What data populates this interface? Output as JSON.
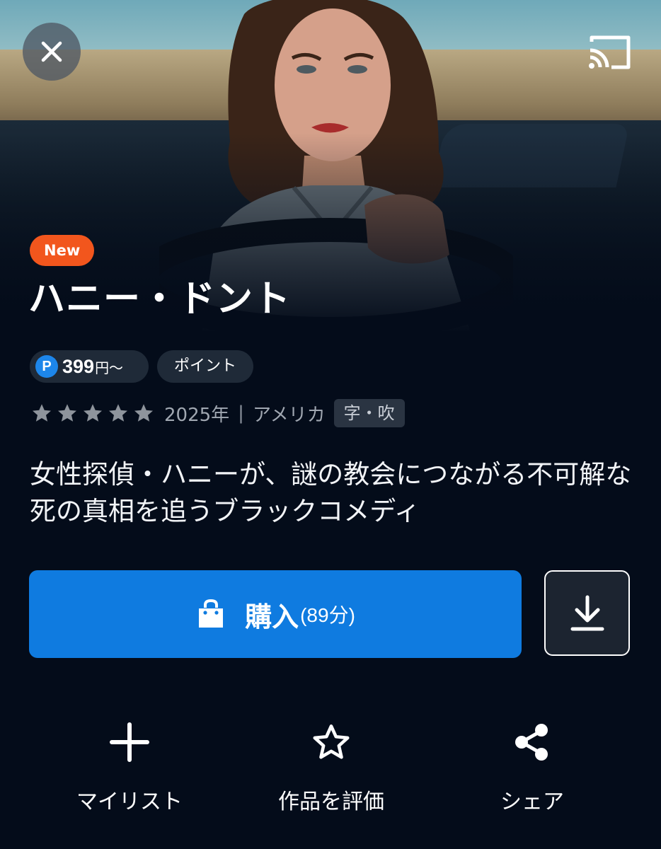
{
  "hero": {
    "close_icon": "close-icon",
    "cast_icon": "cast-icon"
  },
  "badge": {
    "label": "New",
    "color": "#f2561d"
  },
  "title": "ハニー・ドント",
  "price": {
    "point_symbol": "P",
    "amount": "399",
    "unit": "円〜",
    "payment_tag": "ポイント"
  },
  "meta": {
    "rating_stars": 5,
    "year": "2025年",
    "separator": "|",
    "country": "アメリカ",
    "language_tag": "字・吹"
  },
  "synopsis": "女性探偵・ハニーが、謎の教会につながる不可解な死の真相を追うブラックコメディ",
  "purchase": {
    "label": "購入",
    "duration": "(89分)",
    "icon": "shopping-bag-icon",
    "color": "#0f7be0"
  },
  "download": {
    "icon": "download-icon"
  },
  "actions": [
    {
      "label": "マイリスト",
      "icon": "plus-icon"
    },
    {
      "label": "作品を評価",
      "icon": "star-outline-icon"
    },
    {
      "label": "シェア",
      "icon": "share-icon"
    }
  ]
}
